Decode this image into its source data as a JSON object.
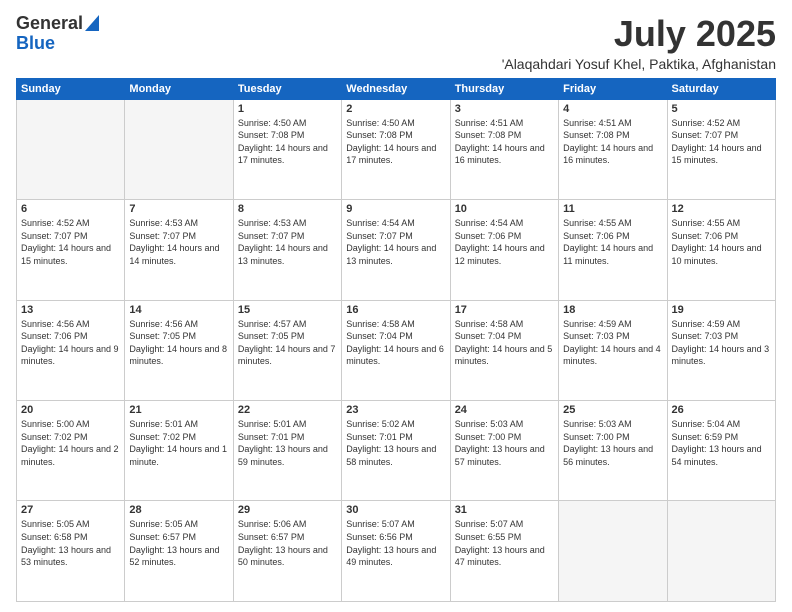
{
  "logo": {
    "general": "General",
    "blue": "Blue"
  },
  "title": {
    "month": "July 2025",
    "location": "'Alaqahdari Yosuf Khel, Paktika, Afghanistan"
  },
  "headers": [
    "Sunday",
    "Monday",
    "Tuesday",
    "Wednesday",
    "Thursday",
    "Friday",
    "Saturday"
  ],
  "days": [
    {
      "num": "",
      "info": ""
    },
    {
      "num": "",
      "info": ""
    },
    {
      "num": "1",
      "info": "Sunrise: 4:50 AM\nSunset: 7:08 PM\nDaylight: 14 hours and 17 minutes."
    },
    {
      "num": "2",
      "info": "Sunrise: 4:50 AM\nSunset: 7:08 PM\nDaylight: 14 hours and 17 minutes."
    },
    {
      "num": "3",
      "info": "Sunrise: 4:51 AM\nSunset: 7:08 PM\nDaylight: 14 hours and 16 minutes."
    },
    {
      "num": "4",
      "info": "Sunrise: 4:51 AM\nSunset: 7:08 PM\nDaylight: 14 hours and 16 minutes."
    },
    {
      "num": "5",
      "info": "Sunrise: 4:52 AM\nSunset: 7:07 PM\nDaylight: 14 hours and 15 minutes."
    },
    {
      "num": "6",
      "info": "Sunrise: 4:52 AM\nSunset: 7:07 PM\nDaylight: 14 hours and 15 minutes."
    },
    {
      "num": "7",
      "info": "Sunrise: 4:53 AM\nSunset: 7:07 PM\nDaylight: 14 hours and 14 minutes."
    },
    {
      "num": "8",
      "info": "Sunrise: 4:53 AM\nSunset: 7:07 PM\nDaylight: 14 hours and 13 minutes."
    },
    {
      "num": "9",
      "info": "Sunrise: 4:54 AM\nSunset: 7:07 PM\nDaylight: 14 hours and 13 minutes."
    },
    {
      "num": "10",
      "info": "Sunrise: 4:54 AM\nSunset: 7:06 PM\nDaylight: 14 hours and 12 minutes."
    },
    {
      "num": "11",
      "info": "Sunrise: 4:55 AM\nSunset: 7:06 PM\nDaylight: 14 hours and 11 minutes."
    },
    {
      "num": "12",
      "info": "Sunrise: 4:55 AM\nSunset: 7:06 PM\nDaylight: 14 hours and 10 minutes."
    },
    {
      "num": "13",
      "info": "Sunrise: 4:56 AM\nSunset: 7:06 PM\nDaylight: 14 hours and 9 minutes."
    },
    {
      "num": "14",
      "info": "Sunrise: 4:56 AM\nSunset: 7:05 PM\nDaylight: 14 hours and 8 minutes."
    },
    {
      "num": "15",
      "info": "Sunrise: 4:57 AM\nSunset: 7:05 PM\nDaylight: 14 hours and 7 minutes."
    },
    {
      "num": "16",
      "info": "Sunrise: 4:58 AM\nSunset: 7:04 PM\nDaylight: 14 hours and 6 minutes."
    },
    {
      "num": "17",
      "info": "Sunrise: 4:58 AM\nSunset: 7:04 PM\nDaylight: 14 hours and 5 minutes."
    },
    {
      "num": "18",
      "info": "Sunrise: 4:59 AM\nSunset: 7:03 PM\nDaylight: 14 hours and 4 minutes."
    },
    {
      "num": "19",
      "info": "Sunrise: 4:59 AM\nSunset: 7:03 PM\nDaylight: 14 hours and 3 minutes."
    },
    {
      "num": "20",
      "info": "Sunrise: 5:00 AM\nSunset: 7:02 PM\nDaylight: 14 hours and 2 minutes."
    },
    {
      "num": "21",
      "info": "Sunrise: 5:01 AM\nSunset: 7:02 PM\nDaylight: 14 hours and 1 minute."
    },
    {
      "num": "22",
      "info": "Sunrise: 5:01 AM\nSunset: 7:01 PM\nDaylight: 13 hours and 59 minutes."
    },
    {
      "num": "23",
      "info": "Sunrise: 5:02 AM\nSunset: 7:01 PM\nDaylight: 13 hours and 58 minutes."
    },
    {
      "num": "24",
      "info": "Sunrise: 5:03 AM\nSunset: 7:00 PM\nDaylight: 13 hours and 57 minutes."
    },
    {
      "num": "25",
      "info": "Sunrise: 5:03 AM\nSunset: 7:00 PM\nDaylight: 13 hours and 56 minutes."
    },
    {
      "num": "26",
      "info": "Sunrise: 5:04 AM\nSunset: 6:59 PM\nDaylight: 13 hours and 54 minutes."
    },
    {
      "num": "27",
      "info": "Sunrise: 5:05 AM\nSunset: 6:58 PM\nDaylight: 13 hours and 53 minutes."
    },
    {
      "num": "28",
      "info": "Sunrise: 5:05 AM\nSunset: 6:57 PM\nDaylight: 13 hours and 52 minutes."
    },
    {
      "num": "29",
      "info": "Sunrise: 5:06 AM\nSunset: 6:57 PM\nDaylight: 13 hours and 50 minutes."
    },
    {
      "num": "30",
      "info": "Sunrise: 5:07 AM\nSunset: 6:56 PM\nDaylight: 13 hours and 49 minutes."
    },
    {
      "num": "31",
      "info": "Sunrise: 5:07 AM\nSunset: 6:55 PM\nDaylight: 13 hours and 47 minutes."
    },
    {
      "num": "",
      "info": ""
    },
    {
      "num": "",
      "info": ""
    },
    {
      "num": "",
      "info": ""
    }
  ]
}
